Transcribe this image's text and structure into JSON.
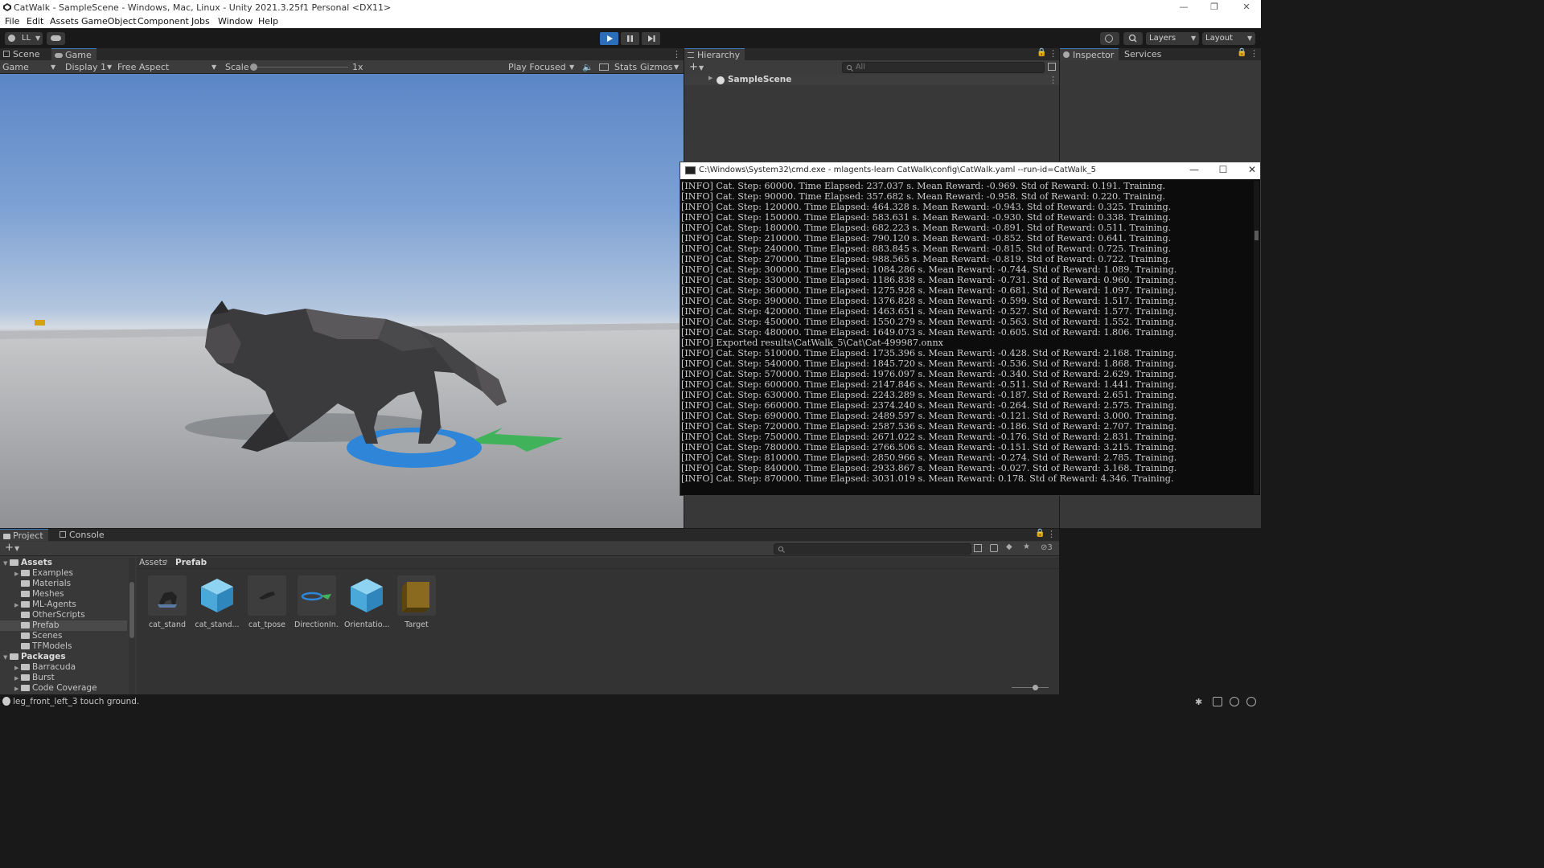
{
  "window": {
    "title": "CatWalk - SampleScene - Windows, Mac, Linux - Unity 2021.3.25f1 Personal <DX11>",
    "minimize": "—",
    "maximize": "❐",
    "close": "✕"
  },
  "menu": [
    "File",
    "Edit",
    "Assets",
    "GameObject",
    "Component",
    "Jobs",
    "Window",
    "Help"
  ],
  "toolbar": {
    "account": "LL",
    "layers": "Layers",
    "layout": "Layout"
  },
  "scene_tabs": [
    "Scene",
    "Game"
  ],
  "game_toolbar": {
    "mode": "Game",
    "display": "Display 1",
    "aspect": "Free Aspect",
    "scale_label": "Scale",
    "scale_value": "1x",
    "play_mode": "Play Focused",
    "stats": "Stats",
    "gizmos": "Gizmos"
  },
  "hierarchy": {
    "tab": "Hierarchy",
    "search_placeholder": "All",
    "scene": "SampleScene"
  },
  "inspector": {
    "tabs": [
      "Inspector",
      "Services"
    ]
  },
  "cmd": {
    "title": "C:\\Windows\\System32\\cmd.exe - mlagents-learn  CatWalk\\config\\CatWalk.yaml --run-id=CatWalk_5",
    "lines": [
      "[INFO] Cat. Step: 60000. Time Elapsed: 237.037 s. Mean Reward: -0.969. Std of Reward: 0.191. Training.",
      "[INFO] Cat. Step: 90000. Time Elapsed: 357.682 s. Mean Reward: -0.958. Std of Reward: 0.220. Training.",
      "[INFO] Cat. Step: 120000. Time Elapsed: 464.328 s. Mean Reward: -0.943. Std of Reward: 0.325. Training.",
      "[INFO] Cat. Step: 150000. Time Elapsed: 583.631 s. Mean Reward: -0.930. Std of Reward: 0.338. Training.",
      "[INFO] Cat. Step: 180000. Time Elapsed: 682.223 s. Mean Reward: -0.891. Std of Reward: 0.511. Training.",
      "[INFO] Cat. Step: 210000. Time Elapsed: 790.120 s. Mean Reward: -0.852. Std of Reward: 0.641. Training.",
      "[INFO] Cat. Step: 240000. Time Elapsed: 883.845 s. Mean Reward: -0.815. Std of Reward: 0.725. Training.",
      "[INFO] Cat. Step: 270000. Time Elapsed: 988.565 s. Mean Reward: -0.819. Std of Reward: 0.722. Training.",
      "[INFO] Cat. Step: 300000. Time Elapsed: 1084.286 s. Mean Reward: -0.744. Std of Reward: 1.089. Training.",
      "[INFO] Cat. Step: 330000. Time Elapsed: 1186.838 s. Mean Reward: -0.731. Std of Reward: 0.960. Training.",
      "[INFO] Cat. Step: 360000. Time Elapsed: 1275.928 s. Mean Reward: -0.681. Std of Reward: 1.097. Training.",
      "[INFO] Cat. Step: 390000. Time Elapsed: 1376.828 s. Mean Reward: -0.599. Std of Reward: 1.517. Training.",
      "[INFO] Cat. Step: 420000. Time Elapsed: 1463.651 s. Mean Reward: -0.527. Std of Reward: 1.577. Training.",
      "[INFO] Cat. Step: 450000. Time Elapsed: 1550.279 s. Mean Reward: -0.563. Std of Reward: 1.552. Training.",
      "[INFO] Cat. Step: 480000. Time Elapsed: 1649.073 s. Mean Reward: -0.605. Std of Reward: 1.806. Training.",
      "[INFO] Exported results\\CatWalk_5\\Cat\\Cat-499987.onnx",
      "[INFO] Cat. Step: 510000. Time Elapsed: 1735.396 s. Mean Reward: -0.428. Std of Reward: 2.168. Training.",
      "[INFO] Cat. Step: 540000. Time Elapsed: 1845.720 s. Mean Reward: -0.536. Std of Reward: 1.868. Training.",
      "[INFO] Cat. Step: 570000. Time Elapsed: 1976.097 s. Mean Reward: -0.340. Std of Reward: 2.629. Training.",
      "[INFO] Cat. Step: 600000. Time Elapsed: 2147.846 s. Mean Reward: -0.511. Std of Reward: 1.441. Training.",
      "[INFO] Cat. Step: 630000. Time Elapsed: 2243.289 s. Mean Reward: -0.187. Std of Reward: 2.651. Training.",
      "[INFO] Cat. Step: 660000. Time Elapsed: 2374.240 s. Mean Reward: -0.264. Std of Reward: 2.575. Training.",
      "[INFO] Cat. Step: 690000. Time Elapsed: 2489.597 s. Mean Reward: -0.121. Std of Reward: 3.000. Training.",
      "[INFO] Cat. Step: 720000. Time Elapsed: 2587.536 s. Mean Reward: -0.186. Std of Reward: 2.707. Training.",
      "[INFO] Cat. Step: 750000. Time Elapsed: 2671.022 s. Mean Reward: -0.176. Std of Reward: 2.831. Training.",
      "[INFO] Cat. Step: 780000. Time Elapsed: 2766.506 s. Mean Reward: -0.151. Std of Reward: 3.215. Training.",
      "[INFO] Cat. Step: 810000. Time Elapsed: 2850.966 s. Mean Reward: -0.274. Std of Reward: 2.785. Training.",
      "[INFO] Cat. Step: 840000. Time Elapsed: 2933.867 s. Mean Reward: -0.027. Std of Reward: 3.168. Training.",
      "[INFO] Cat. Step: 870000. Time Elapsed: 3031.019 s. Mean Reward: 0.178. Std of Reward: 4.346. Training."
    ]
  },
  "project": {
    "tabs": [
      "Project",
      "Console"
    ],
    "breadcrumb": [
      "Assets",
      "Prefab"
    ],
    "hidden_count": "3",
    "tree": [
      {
        "label": "Assets",
        "level": 0,
        "bold": true,
        "expanded": true
      },
      {
        "label": "Examples",
        "level": 1,
        "arrow": true
      },
      {
        "label": "Materials",
        "level": 1
      },
      {
        "label": "Meshes",
        "level": 1
      },
      {
        "label": "ML-Agents",
        "level": 1,
        "arrow": true
      },
      {
        "label": "OtherScripts",
        "level": 1
      },
      {
        "label": "Prefab",
        "level": 1,
        "selected": true
      },
      {
        "label": "Scenes",
        "level": 1
      },
      {
        "label": "TFModels",
        "level": 1
      },
      {
        "label": "Packages",
        "level": 0,
        "bold": true,
        "expanded": true
      },
      {
        "label": "Barracuda",
        "level": 1,
        "arrow": true
      },
      {
        "label": "Burst",
        "level": 1,
        "arrow": true
      },
      {
        "label": "Code Coverage",
        "level": 1,
        "arrow": true
      }
    ],
    "assets": [
      {
        "label": "cat_stand",
        "kind": "cat"
      },
      {
        "label": "cat_stand...",
        "kind": "cube-blue"
      },
      {
        "label": "cat_tpose",
        "kind": "cat-small"
      },
      {
        "label": "DirectionIn...",
        "kind": "ring"
      },
      {
        "label": "Orientatio...",
        "kind": "cube-blue"
      },
      {
        "label": "Target",
        "kind": "cube-gold"
      }
    ]
  },
  "status": {
    "message": "leg_front_left_3 touch ground."
  }
}
